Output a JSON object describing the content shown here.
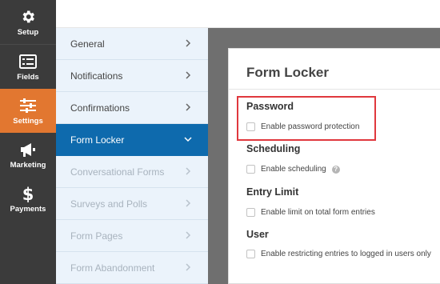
{
  "rail": {
    "items": [
      {
        "label": "Setup",
        "icon": "gear-icon"
      },
      {
        "label": "Fields",
        "icon": "list-icon"
      },
      {
        "label": "Settings",
        "icon": "sliders-icon",
        "active": true
      },
      {
        "label": "Marketing",
        "icon": "megaphone-icon"
      },
      {
        "label": "Payments",
        "icon": "dollar-icon"
      }
    ],
    "active_color": "#e27730",
    "background": "#3b3b3b"
  },
  "submenu": {
    "items": [
      {
        "label": "General"
      },
      {
        "label": "Notifications"
      },
      {
        "label": "Confirmations"
      },
      {
        "label": "Form Locker",
        "active": true
      },
      {
        "label": "Conversational Forms",
        "disabled": true
      },
      {
        "label": "Surveys and Polls",
        "disabled": true
      },
      {
        "label": "Form Pages",
        "disabled": true
      },
      {
        "label": "Form Abandonment",
        "disabled": true
      }
    ],
    "active_color": "#0e6aad"
  },
  "panel": {
    "title": "Form Locker",
    "sections": [
      {
        "heading": "Password",
        "option": "Enable password protection",
        "highlighted": true
      },
      {
        "heading": "Scheduling",
        "option": "Enable scheduling",
        "help_icon": true
      },
      {
        "heading": "Entry Limit",
        "option": "Enable limit on total form entries"
      },
      {
        "heading": "User",
        "option": "Enable restricting entries to logged in users only"
      }
    ],
    "help_symbol": "?"
  }
}
